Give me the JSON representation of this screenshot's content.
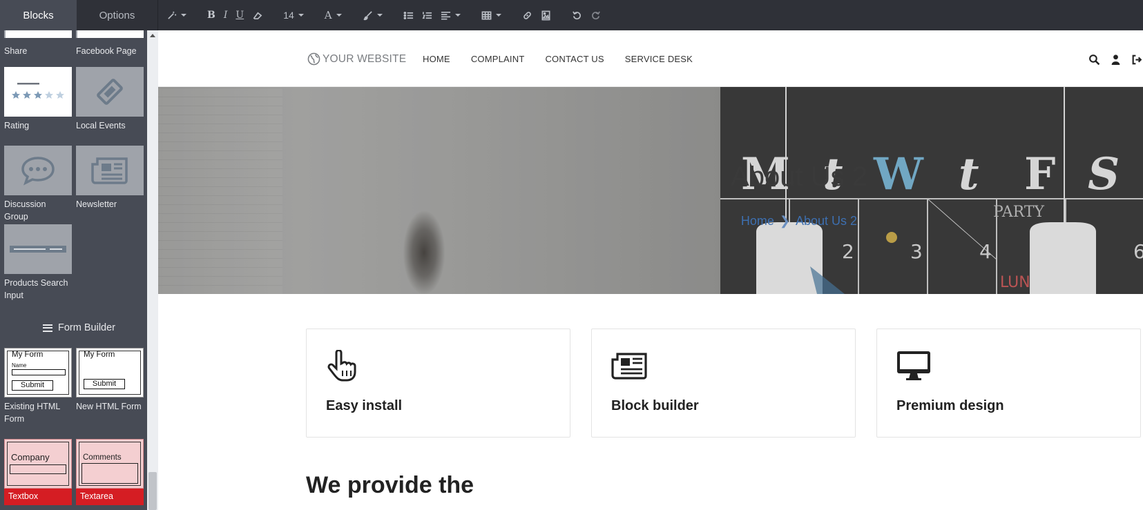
{
  "sidebar_tabs": {
    "blocks": "Blocks",
    "options": "Options"
  },
  "toolbar": {
    "font_size": "14"
  },
  "blocks": {
    "share": "Share",
    "facebook": "Facebook Page",
    "rating": "Rating",
    "local_events": "Local Events",
    "discussion": "Discussion Group",
    "newsletter": "Newsletter",
    "products_search": "Products Search Input",
    "form_builder": "Form Builder",
    "existing_form": "Existing HTML Form",
    "new_form": "New HTML Form",
    "textbox": "Textbox",
    "textarea": "Textarea"
  },
  "thumbs": {
    "my_form": "My Form",
    "name": "Name",
    "submit": "Submit",
    "company": "Company",
    "comments": "Comments"
  },
  "site": {
    "logo": "YOUR WEBSITE",
    "menu": [
      "HOME",
      "COMPLAINT",
      "CONTACT US",
      "SERVICE DESK"
    ],
    "hero_title": "About Us 2",
    "breadcrumb": {
      "home": "Home",
      "current": "About Us 2"
    },
    "features": [
      "Easy install",
      "Block builder",
      "Premium design"
    ],
    "provide": "We provide the"
  },
  "colors": {
    "topbar": "#2f3138",
    "panel": "#474b55",
    "active_tab": "#474b55",
    "link": "#3d6fb0",
    "danger": "#d51d23"
  }
}
